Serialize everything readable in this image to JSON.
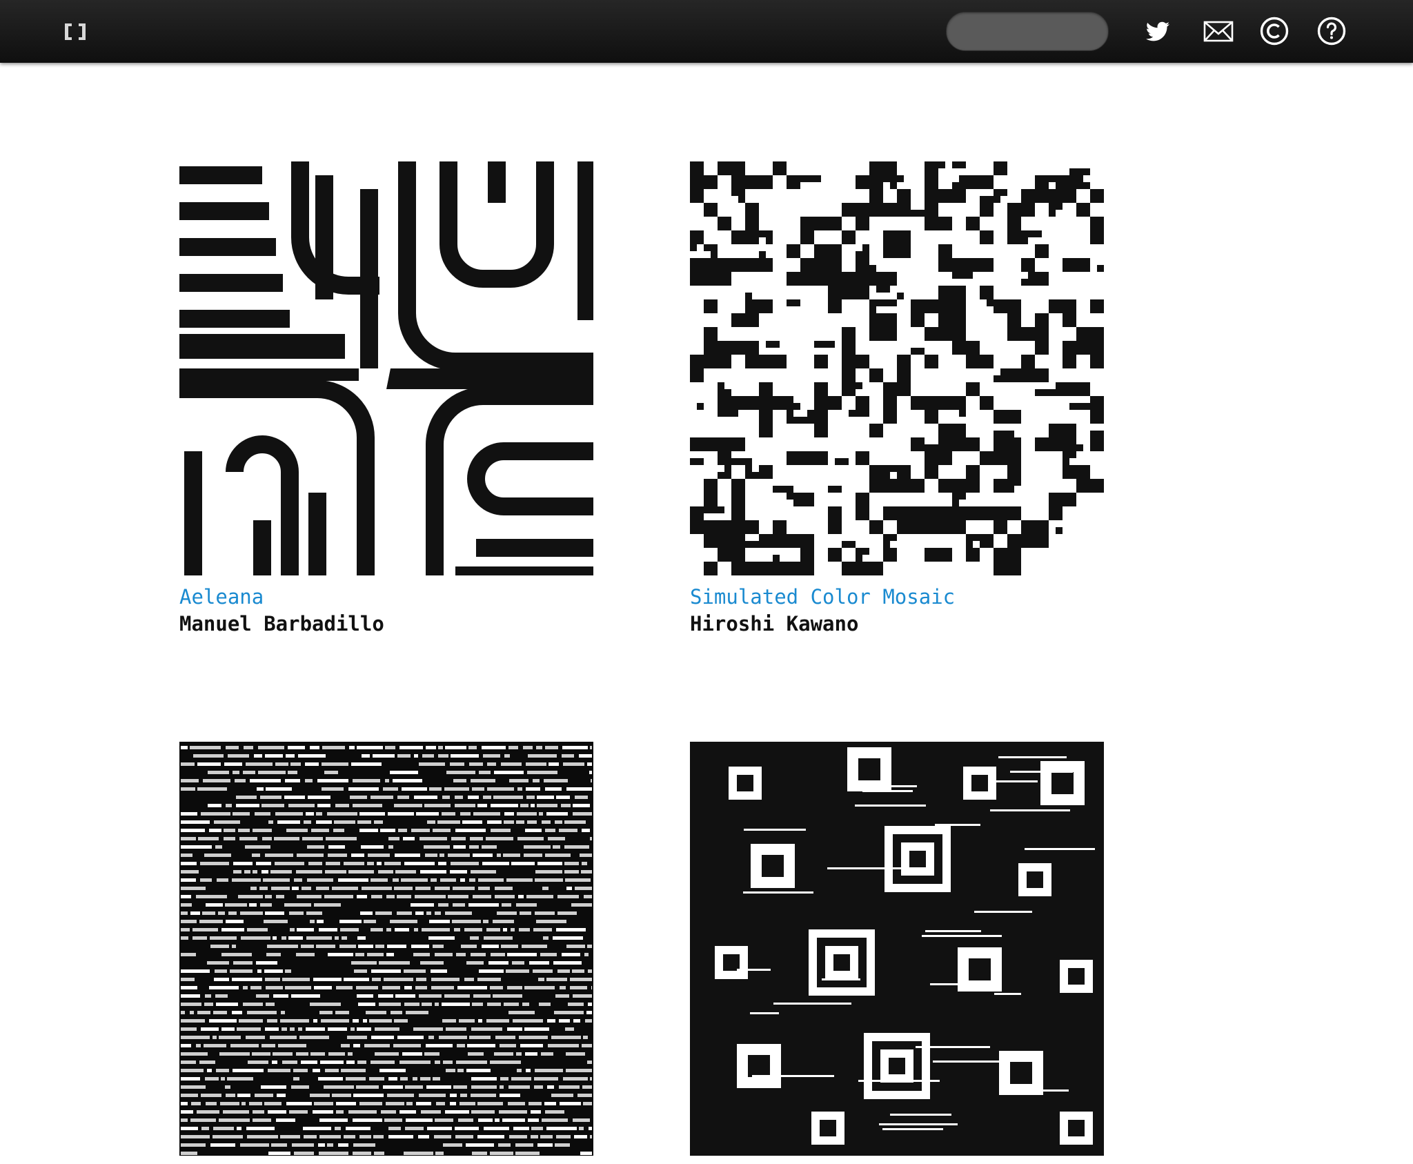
{
  "header": {
    "search": {
      "value": "",
      "placeholder": ""
    },
    "icons": [
      "bracket-logo-icon",
      "twitter-bird-icon",
      "mail-envelope-icon",
      "copyright-icon",
      "help-question-icon"
    ]
  },
  "gallery": [
    {
      "title": "Aeleana",
      "artist": "Manuel Barbadillo"
    },
    {
      "title": "Simulated Color Mosaic",
      "artist": "Hiroshi Kawano"
    },
    {
      "title": "",
      "artist": ""
    },
    {
      "title": "",
      "artist": ""
    }
  ],
  "colors": {
    "topbar": "#1a1a1a",
    "link": "#1a8ad0",
    "artist": "#111111",
    "search": "#5a5a5a"
  }
}
